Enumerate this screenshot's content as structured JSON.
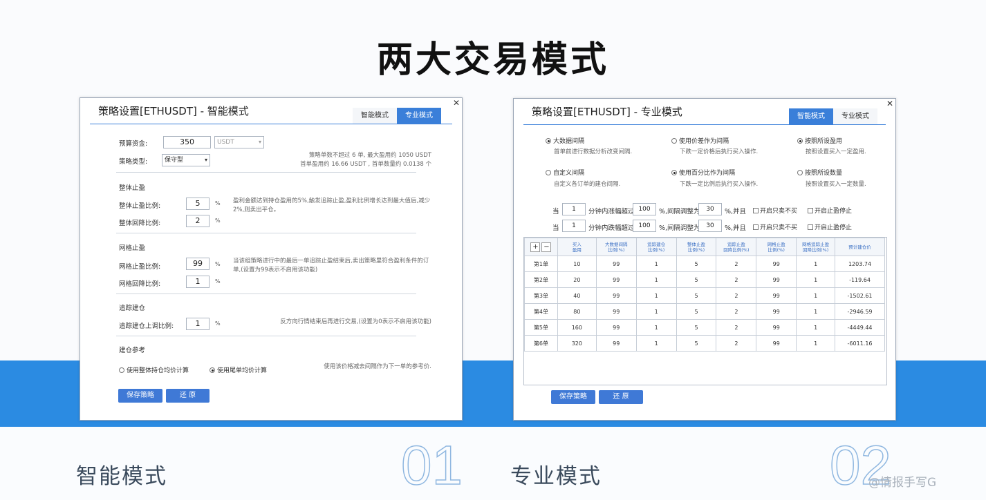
{
  "headline": "两大交易模式",
  "smart": {
    "title": "策略设置[ETHUSDT] - 智能模式",
    "tabs": [
      "智能模式",
      "专业模式"
    ],
    "budget_label": "预算资金:",
    "budget_value": "350",
    "currency": "USDT",
    "type_label": "策略类型:",
    "type_value": "保守型",
    "summary_line1": "策略单数不超过 6 单, 最大盈用约 1050 USDT",
    "summary_line2": "首单盈用约 16.66 USDT , 首单数量约 0.0138 个",
    "section1": "整体止盈",
    "tp_ratio_label": "整体止盈比例:",
    "tp_ratio_value": "5",
    "tp_pullback_label": "整体回降比例:",
    "tp_pullback_value": "2",
    "section1_note": "盈利金额达到持仓盈用的5%,触发追踪止盈,盈利比例增长达到最大值后,减少2%,则卖出平仓。",
    "section2": "网格止盈",
    "grid_tp_label": "网格止盈比例:",
    "grid_tp_value": "99",
    "grid_pullback_label": "网格回降比例:",
    "grid_pullback_value": "1",
    "section2_note": "当该组策略进行中的最后一单追踪止盈结束后,卖出策略里符合盈利条件的订单,(设置为99表示不启用该功能)",
    "section3": "追踪建仓",
    "trace_label": "追踪建仓上调比例:",
    "trace_value": "1",
    "section3_note": "反方向行情结束后再进行交易,(设置为0表示不启用该功能)",
    "section4": "建仓参考",
    "radio_a": "使用整体持仓均价计算",
    "radio_b": "使用尾单均价计算",
    "section4_note": "使用该价格减去间隔作为下一单的参考价.",
    "unit": "%",
    "save_label": "保存策略",
    "reset_label": "还 原"
  },
  "pro": {
    "title": "策略设置[ETHUSDT] - 专业模式",
    "tabs": [
      "智能模式",
      "专业模式"
    ],
    "opt1_title": "大数据间隔",
    "opt1_desc": "首单前进行数据分析改变间隔.",
    "opt2_title": "使用价差作为间隔",
    "opt2_desc": "下跌一定价格后执行买入操作.",
    "opt3_title": "按照所设盈用",
    "opt3_desc": "按照设置买入一定盈用.",
    "opt4_title": "自定义间隔",
    "opt4_desc": "自定义各订单的建仓间隔.",
    "opt5_title": "使用百分比作为间隔",
    "opt5_desc": "下跌一定比例后执行买入操作.",
    "opt6_title": "按照所设数量",
    "opt6_desc": "按照设置买入一定数量.",
    "cond_rows": [
      {
        "pre": "当",
        "min": "1",
        "mid": "分钟内涨幅超过",
        "pct": "100",
        "adj": "%,间隔调整为",
        "val": "30",
        "tail": "%,并且",
        "chk1": "开启只卖不买",
        "chk2": "开启止盈停止"
      },
      {
        "pre": "当",
        "min": "1",
        "mid": "分钟内跌幅超过",
        "pct": "100",
        "adj": "%,间隔调整为",
        "val": "30",
        "tail": "%,并且",
        "chk1": "开启只卖不买",
        "chk2": "开启止盈停止"
      }
    ],
    "columns": [
      "买入\n盈用",
      "大数据间隔\n比例(%)",
      "追踪建仓\n比例(%)",
      "整体止盈\n比例(%)",
      "追踪止盈\n回降比例(%)",
      "网格止盈\n比例(%)",
      "网格追踪止盈\n回降比例(%)",
      "预计建仓价"
    ],
    "rows": [
      {
        "label": "第1单",
        "cells": [
          "10",
          "99",
          "1",
          "5",
          "2",
          "99",
          "1",
          "1203.74"
        ]
      },
      {
        "label": "第2单",
        "cells": [
          "20",
          "99",
          "1",
          "5",
          "2",
          "99",
          "1",
          "-119.64"
        ]
      },
      {
        "label": "第3单",
        "cells": [
          "40",
          "99",
          "1",
          "5",
          "2",
          "99",
          "1",
          "-1502.61"
        ]
      },
      {
        "label": "第4单",
        "cells": [
          "80",
          "99",
          "1",
          "5",
          "2",
          "99",
          "1",
          "-2946.59"
        ]
      },
      {
        "label": "第5单",
        "cells": [
          "160",
          "99",
          "1",
          "5",
          "2",
          "99",
          "1",
          "-4449.44"
        ]
      },
      {
        "label": "第6单",
        "cells": [
          "320",
          "99",
          "1",
          "5",
          "2",
          "99",
          "1",
          "-6011.16"
        ]
      }
    ],
    "plus": "+",
    "minus": "−",
    "save_label": "保存策略",
    "reset_label": "还 原"
  },
  "footer": {
    "left_title": "智能模式",
    "left_num": "01",
    "right_title": "专业模式",
    "right_num": "02",
    "watermark": "@情报手写G"
  }
}
